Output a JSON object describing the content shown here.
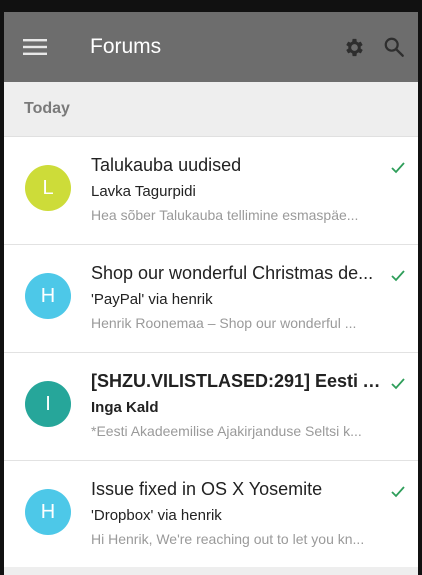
{
  "app_bar": {
    "title": "Forums",
    "icons": [
      "menu-icon",
      "gear-icon",
      "search-icon"
    ]
  },
  "section": {
    "label": "Today"
  },
  "colors": {
    "app_bar": "#6d6d6d",
    "check": "#2e9e5a"
  },
  "threads": [
    {
      "avatar_letter": "L",
      "avatar_color": "#cddc39",
      "subject": "Talukauba uudised",
      "sender": "Lavka Tagurpidi",
      "snippet": "Hea sõber Talukauba tellimine esmaspäe...",
      "unread": false
    },
    {
      "avatar_letter": "H",
      "avatar_color": "#4dc8e8",
      "subject": "Shop our wonderful Christmas de...",
      "sender": "'PayPal' via henrik",
      "snippet": "Henrik Roonemaa – Shop our wonderful ...",
      "unread": false
    },
    {
      "avatar_letter": "I",
      "avatar_color": "#26a69a",
      "subject": "[SHZU.VILISTLASED:291] Eesti A...",
      "sender": "Inga Kald",
      "snippet": "*Eesti Akadeemilise Ajakirjanduse Seltsi k...",
      "unread": true
    },
    {
      "avatar_letter": "H",
      "avatar_color": "#4dc8e8",
      "subject": "Issue fixed in OS X Yosemite",
      "sender": "'Dropbox' via henrik",
      "snippet": "Hi Henrik, We're reaching out to let you kn...",
      "unread": false
    }
  ]
}
